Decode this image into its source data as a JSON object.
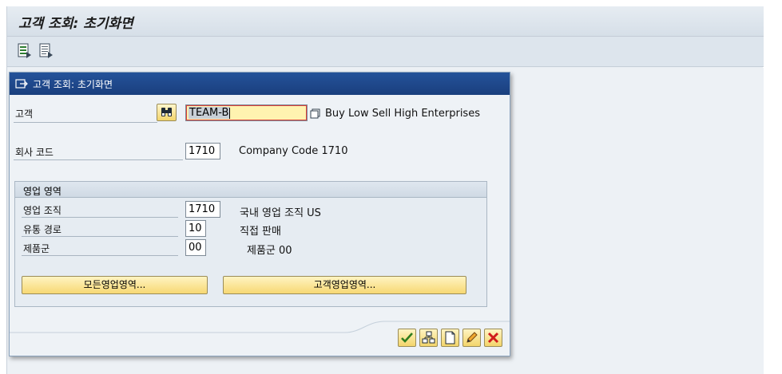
{
  "window": {
    "title": "고객 조회: 초기화면"
  },
  "toolbar": {
    "icons": [
      "document-list-icon",
      "document-detail-icon"
    ]
  },
  "dialog": {
    "title": "고객 조회: 초기화면",
    "customer": {
      "label": "고객",
      "value_selected": "TEAM-B",
      "description": "Buy Low Sell High Enterprises"
    },
    "company_code": {
      "label": "회사 코드",
      "value": "1710",
      "description": "Company Code 1710"
    },
    "sales_area": {
      "title": "영업 영역",
      "sales_org": {
        "label": "영업 조직",
        "value": "1710",
        "description": "국내 영업 조직 US"
      },
      "distribution_channel": {
        "label": "유통 경로",
        "value": "10",
        "description": "직접 판매"
      },
      "division": {
        "label": "제품군",
        "value": "00",
        "description": "제품군 00"
      },
      "all_sales_areas_button": "모든영업영역...",
      "customer_sales_areas_button": "고객영업영역..."
    },
    "actions": [
      "check-icon",
      "hierarchy-icon",
      "new-document-icon",
      "edit-pencil-icon",
      "cancel-icon"
    ]
  },
  "colors": {
    "dialog_title_bg": "#1a3f7d",
    "button_yellow": "#f7d873",
    "active_field_bg": "#fff3b0"
  }
}
